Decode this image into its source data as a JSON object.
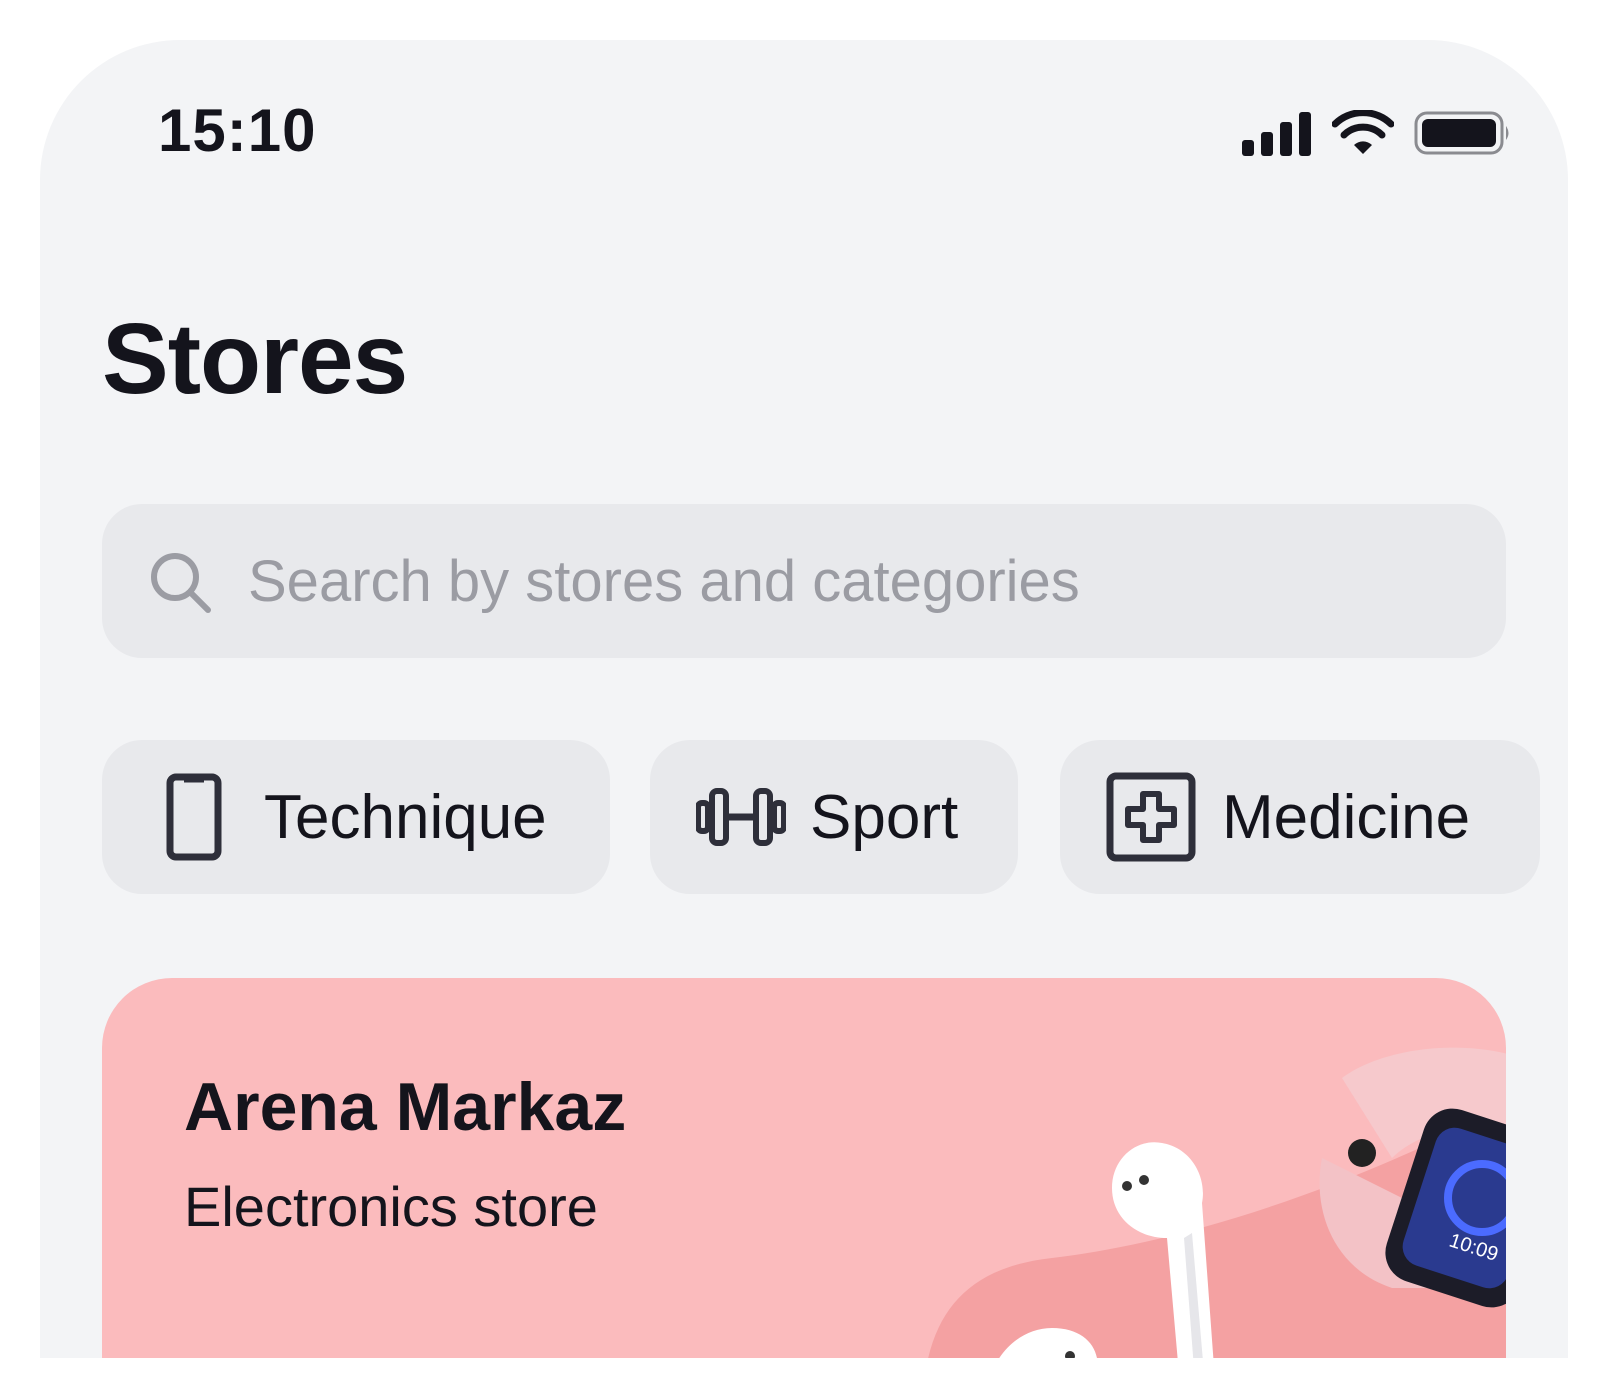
{
  "status_bar": {
    "time": "15:10",
    "icons": [
      "signal-icon",
      "wifi-icon",
      "battery-icon"
    ]
  },
  "page": {
    "title": "Stores"
  },
  "search": {
    "placeholder": "Search by stores and categories",
    "value": "",
    "icon": "search-icon"
  },
  "categories": [
    {
      "label": "Technique",
      "icon": "phone-icon"
    },
    {
      "label": "Sport",
      "icon": "dumbbell-icon"
    },
    {
      "label": "Medicine",
      "icon": "medical-cross-icon"
    }
  ],
  "store_card": {
    "name": "Arena Markaz",
    "description": "Electronics store",
    "background_color": "#fbbbbd",
    "watch_time": "10:09"
  },
  "colors": {
    "background": "#f3f4f6",
    "chip_background": "#e8e9ec",
    "text_primary": "#14141c",
    "placeholder": "#9b9ca3"
  }
}
